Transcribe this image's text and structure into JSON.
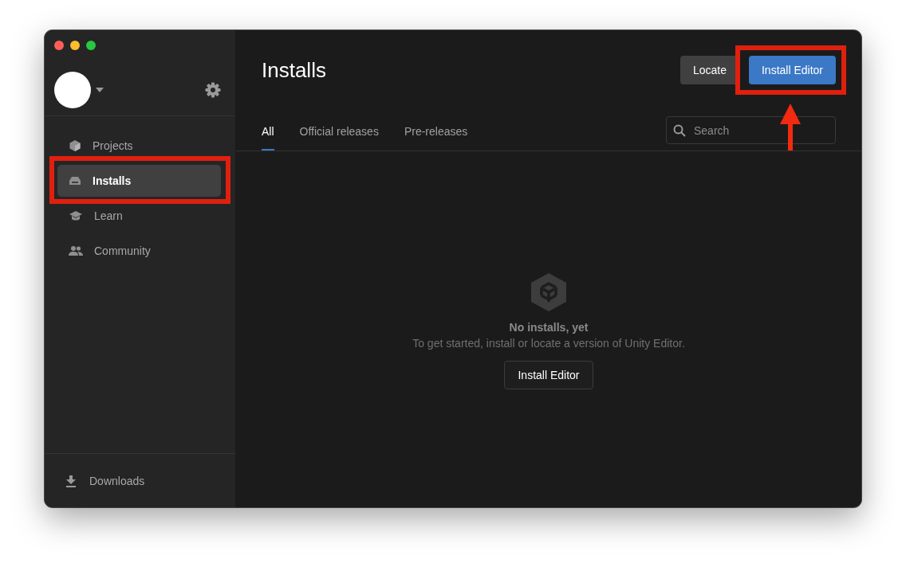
{
  "sidebar": {
    "items": [
      {
        "label": "Projects",
        "selected": false
      },
      {
        "label": "Installs",
        "selected": true
      },
      {
        "label": "Learn",
        "selected": false
      },
      {
        "label": "Community",
        "selected": false
      }
    ],
    "footer": {
      "label": "Downloads"
    }
  },
  "header": {
    "title": "Installs",
    "buttons": [
      {
        "label": "Locate",
        "kind": "secondary"
      },
      {
        "label": "Install Editor",
        "kind": "primary"
      }
    ]
  },
  "tabs": [
    {
      "label": "All",
      "selected": true
    },
    {
      "label": "Official releases",
      "selected": false
    },
    {
      "label": "Pre-releases",
      "selected": false
    }
  ],
  "search": {
    "placeholder": "Search"
  },
  "empty_state": {
    "title": "No installs, yet",
    "message": "To get started, install or locate a version of Unity Editor.",
    "button": "Install Editor"
  }
}
